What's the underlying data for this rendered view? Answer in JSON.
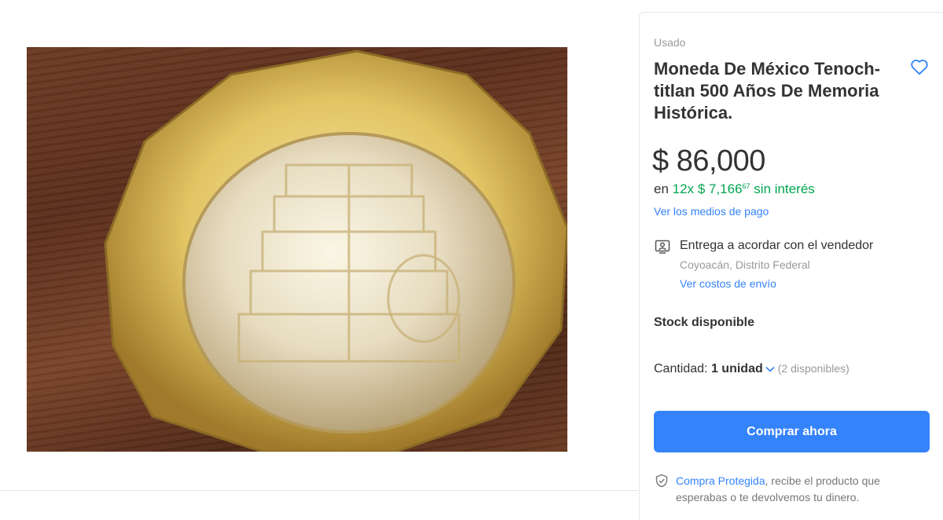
{
  "product": {
    "photo_alt": "",
    "condition": "Usado",
    "title": "Moneda De México Tenoch-titlan 500 Años De Memoria Histórica.",
    "price": "$ 86,000",
    "installments": {
      "prefix": "en",
      "count": "12x",
      "amount": "$ 7,166",
      "cents": "67",
      "suffix": "sin interés"
    },
    "payment_link": "Ver los medios de pago"
  },
  "shipping": {
    "title": "Entrega a acordar con el vendedor",
    "location": "Coyoacán, Distrito Federal",
    "costs_link": "Ver costos de envío"
  },
  "stock": {
    "label": "Stock disponible",
    "quantity_label": "Cantidad:",
    "quantity_value": "1 unidad",
    "available": "(2 disponibles)"
  },
  "actions": {
    "buy_now": "Comprar ahora"
  },
  "protection": {
    "link": "Compra Protegida",
    "text": ", recibe el producto que esperabas o te devolvemos tu dinero."
  },
  "icons": {
    "favorite": "heart-icon",
    "shipping": "person-card-icon",
    "quantity": "chevron-down-icon",
    "protection": "shield-check-icon"
  },
  "colors": {
    "accent": "#3483fa",
    "green": "#00a650"
  }
}
